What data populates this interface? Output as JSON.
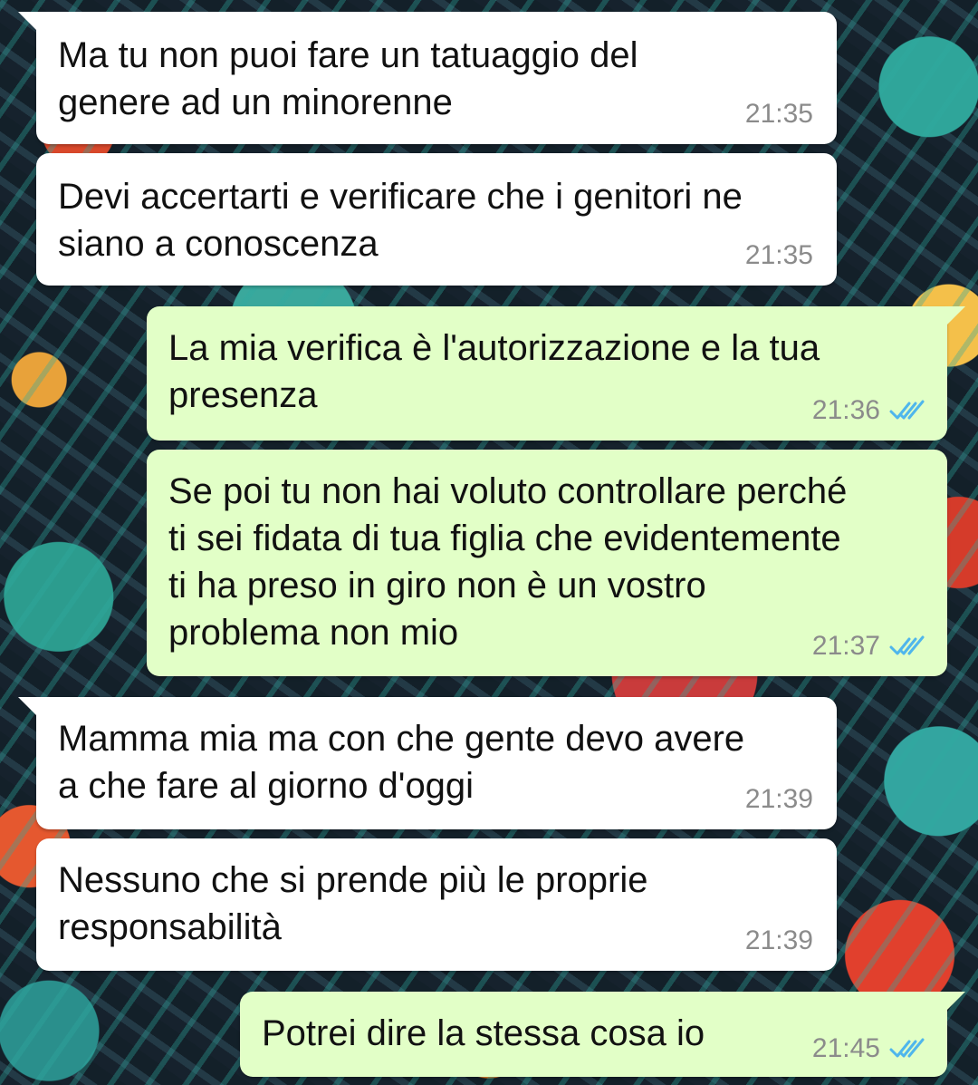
{
  "colors": {
    "incoming_bubble": "#ffffff",
    "outgoing_bubble": "#e2ffc7",
    "timestamp": "#8b8b8b",
    "read_ticks": "#4fb6ec"
  },
  "messages": [
    {
      "direction": "incoming",
      "text": "Ma tu non puoi fare un tatuaggio del\ngenere ad un minorenne",
      "time": "21:35"
    },
    {
      "direction": "incoming",
      "text": "Devi accertarti e verificare che i genitori ne\nsiano a conoscenza",
      "time": "21:35"
    },
    {
      "direction": "outgoing",
      "text": "La mia verifica è l'autorizzazione e la tua\npresenza",
      "time": "21:36",
      "status_icon": "double-check-read-icon"
    },
    {
      "direction": "outgoing",
      "text": "Se poi tu non hai voluto controllare perché\nti sei fidata di tua figlia che evidentemente\nti ha preso in giro non è un vostro\nproblema non mio",
      "time": "21:37",
      "status_icon": "double-check-read-icon"
    },
    {
      "direction": "incoming",
      "text": "Mamma mia ma con che gente devo avere\na che fare al giorno d'oggi",
      "time": "21:39"
    },
    {
      "direction": "incoming",
      "text": "Nessuno che si prende più le proprie\nresponsabilità",
      "time": "21:39"
    },
    {
      "direction": "outgoing",
      "text": "Potrei dire la stessa cosa io",
      "time": "21:45",
      "status_icon": "double-check-read-icon"
    }
  ]
}
